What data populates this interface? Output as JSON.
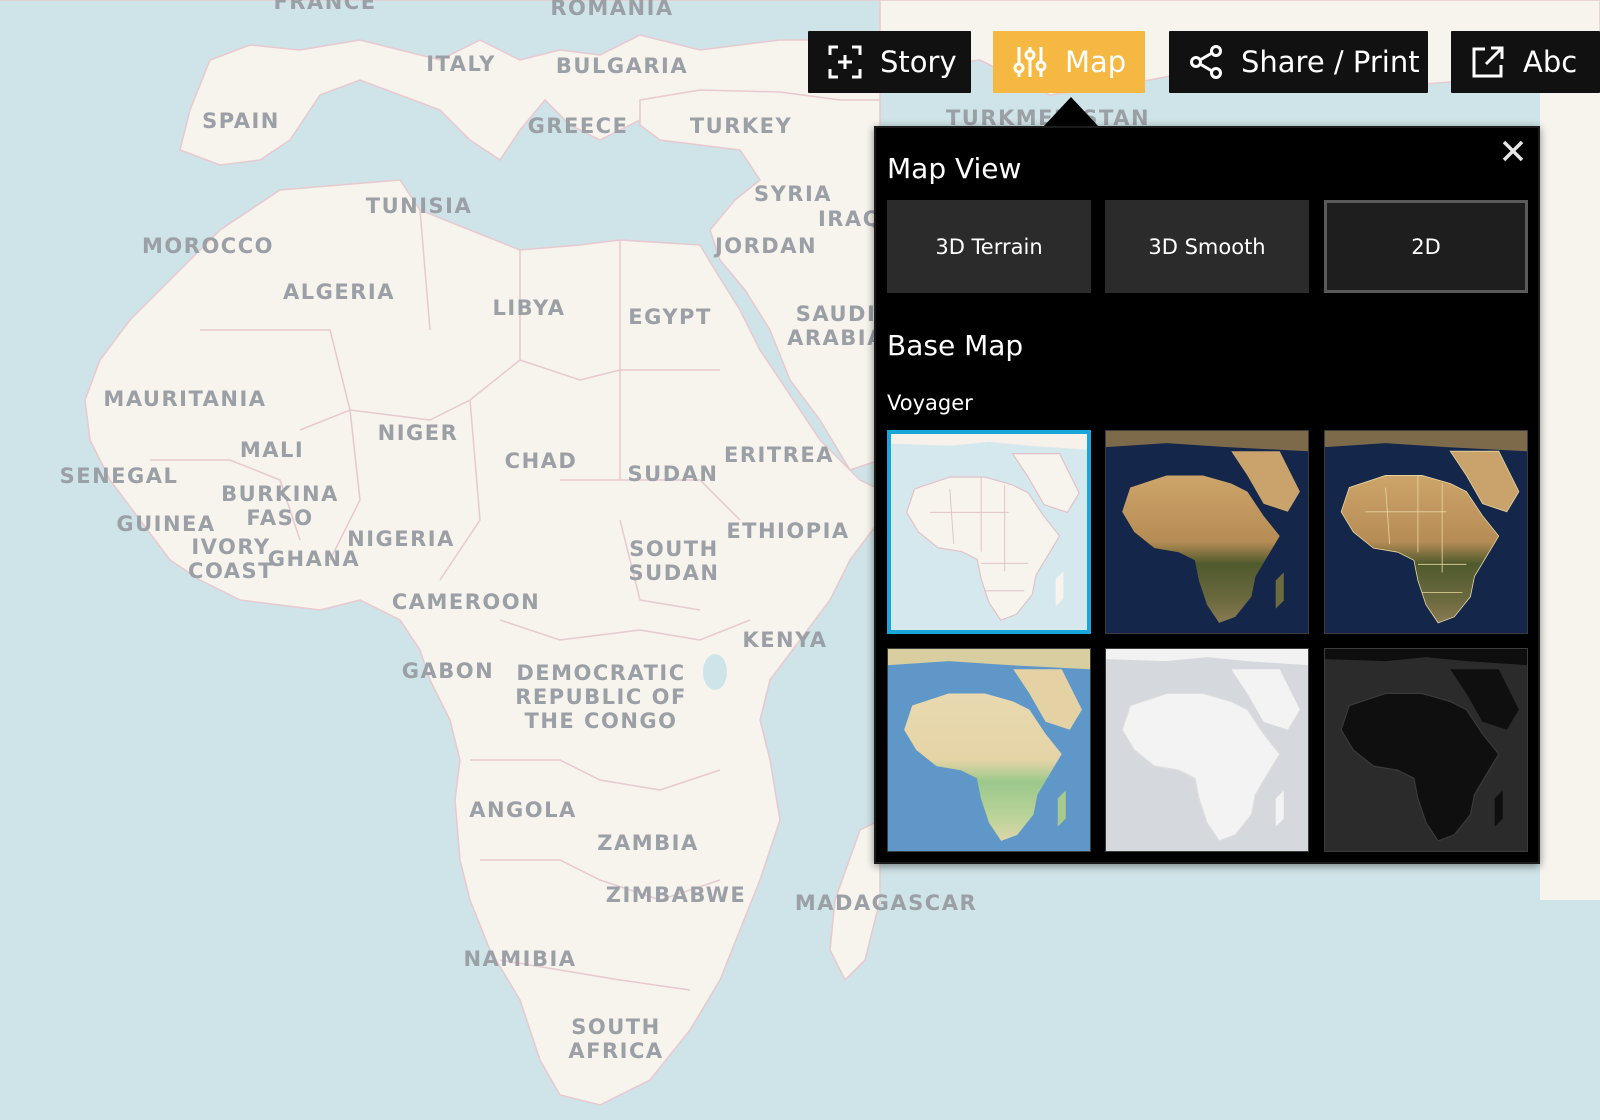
{
  "toolbar": {
    "story_label": "Story",
    "map_label": "Map",
    "share_label": "Share / Print",
    "about_label": "Abc"
  },
  "map": {
    "colors": {
      "land": "#f7f3ed",
      "water": "#cfe4e8",
      "border": "#e7c9cf",
      "label": "#9b9fa6"
    },
    "labels": [
      "FRANCE",
      "ROMANIA",
      "ITALY",
      "BULGARIA",
      "SPAIN",
      "GREECE",
      "TURKEY",
      "TURKMENISTAN",
      "TUNISIA",
      "SYRIA",
      "IRAQ",
      "MOROCCO",
      "JORDAN",
      "ALGERIA",
      "LIBYA",
      "EGYPT",
      "SAUDI\nARABIA",
      "MAURITANIA",
      "NIGER",
      "MALI",
      "CHAD",
      "SUDAN",
      "ERITREA",
      "SENEGAL",
      "BURKINA\nFASO",
      "GUINEA",
      "IVORY\nCOAST",
      "GHANA",
      "NIGERIA",
      "SOUTH\nSUDAN",
      "ETHIOPIA",
      "CAMEROON",
      "KENYA",
      "GABON",
      "DEMOCRATIC\nREPUBLIC OF\nTHE CONGO",
      "ANGOLA",
      "ZAMBIA",
      "ZIMBABWE",
      "MADAGASCAR",
      "NAMIBIA",
      "SOUTH\nAFRICA"
    ]
  },
  "panel": {
    "map_view_heading": "Map View",
    "view_options": [
      "3D Terrain",
      "3D Smooth",
      "2D"
    ],
    "selected_view": "2D",
    "base_map_heading": "Base Map",
    "base_map_selected_name": "Voyager",
    "base_maps": [
      {
        "style": "voyager",
        "selected": true
      },
      {
        "style": "satellite",
        "selected": false
      },
      {
        "style": "satellite-labels",
        "selected": false
      },
      {
        "style": "terrain",
        "selected": false
      },
      {
        "style": "positron",
        "selected": false
      },
      {
        "style": "dark-matter",
        "selected": false
      }
    ],
    "accent_color": "#18a7d8"
  },
  "icons": {
    "story": "story-icon",
    "map": "sliders-icon",
    "share": "share-icon",
    "about": "external-link-icon",
    "close": "close-icon"
  }
}
